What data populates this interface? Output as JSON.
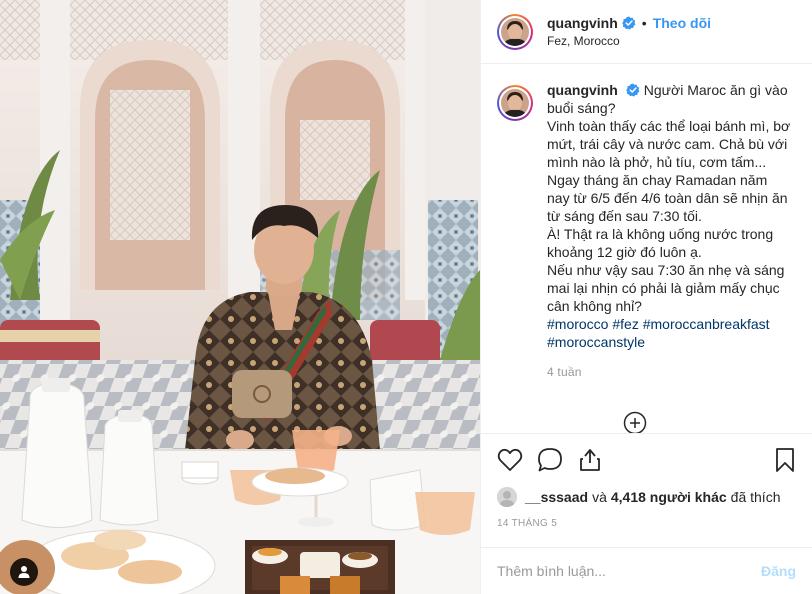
{
  "post": {
    "photo_alt": "Người đàn ông ăn sáng trong sân riad kiểu Maroc",
    "tag_icon": "user-tag-icon"
  },
  "header": {
    "username": "quangvinh",
    "verified_icon": "verified-badge-icon",
    "separator": "•",
    "follow_label": "Theo dõi",
    "location": "Fez, Morocco"
  },
  "caption": {
    "username": "quangvinh",
    "lines": [
      "Người Maroc ăn gì vào buổi sáng?",
      "Vinh toàn thấy các thể loại bánh mì, bơ mứt, trái cây và nước cam. Chả bù với mình nào là phở, hủ tíu, cơm tấm...",
      "Ngay tháng ăn chay Ramadan năm nay từ 6/5 đến 4/6 toàn dân sẽ nhịn ăn từ sáng đến sau 7:30 tối.",
      "À! Thật ra là không uống nước trong khoảng 12 giờ đó luôn ạ.",
      "Nếu như vậy sau 7:30 ăn nhẹ và sáng mai lại nhịn có phải là giảm mấy chục cân không nhỉ?"
    ],
    "hashtags": [
      "#morocco",
      "#fez",
      "#moroccanbreakfast",
      "#moroccanstyle"
    ],
    "time_ago": "4 tuần"
  },
  "load_more_icon": "plus-circle-icon",
  "actions": {
    "like_icon": "heart-icon",
    "comment_icon": "comment-icon",
    "share_icon": "share-icon",
    "save_icon": "bookmark-icon"
  },
  "likes": {
    "first_user": "__sssaad",
    "connector": "và",
    "count_text": "4,418 người khác",
    "suffix": "đã thích"
  },
  "date": "14 THÁNG 5",
  "comment_box": {
    "placeholder": "Thêm bình luận...",
    "post_label": "Đăng"
  },
  "colors": {
    "accent": "#3897f0",
    "hashtag": "#003569",
    "muted": "#999999",
    "post_disabled": "#b2dffc",
    "border": "#efefef"
  }
}
